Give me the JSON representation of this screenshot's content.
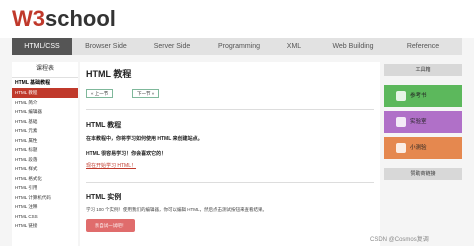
{
  "logo": {
    "w3": "W3",
    "school": "school"
  },
  "nav": [
    {
      "label": "HTML/CSS",
      "active": true
    },
    {
      "label": "Browser Side"
    },
    {
      "label": "Server Side"
    },
    {
      "label": "Programming"
    },
    {
      "label": "XML"
    },
    {
      "label": "Web Building"
    },
    {
      "label": "Reference"
    }
  ],
  "sidebar": {
    "title": "课程表",
    "group": "HTML 基础教程",
    "items": [
      {
        "label": "HTML 教程",
        "active": true
      },
      {
        "label": "HTML 简介"
      },
      {
        "label": "HTML 编辑器"
      },
      {
        "label": "HTML 基础"
      },
      {
        "label": "HTML 元素"
      },
      {
        "label": "HTML 属性"
      },
      {
        "label": "HTML 标题"
      },
      {
        "label": "HTML 段落"
      },
      {
        "label": "HTML 样式"
      },
      {
        "label": "HTML 格式化"
      },
      {
        "label": "HTML 引用"
      },
      {
        "label": "HTML 计算机代码"
      },
      {
        "label": "HTML 注释"
      },
      {
        "label": "HTML CSS"
      },
      {
        "label": "HTML 链接"
      }
    ]
  },
  "main": {
    "title": "HTML 教程",
    "prev": "« 上一节",
    "next": "下一节 »",
    "section1": {
      "title": "HTML 教程",
      "line1": "在本教程中，你将学习如何使用 HTML 来创建站点。",
      "line2": "HTML 很容易学习！你会喜欢它的！",
      "link": "现在开始学习 HTML！"
    },
    "section2": {
      "title": "HTML 实例",
      "desc": "学习 100 个实例！使用我们的编辑器，你可以编辑 HTML，然后点击测试按钮来查看结果。",
      "cta": "亲自试一试吧！"
    }
  },
  "right": {
    "tools_title": "工具箱",
    "tools": [
      {
        "label": "参考书",
        "color": "#5cb85c"
      },
      {
        "label": "实验室",
        "color": "#b070c8"
      },
      {
        "label": "小测验",
        "color": "#e5884f"
      }
    ],
    "sponsor_title": "赞助商链接"
  },
  "watermark": "CSDN @Cosmos复调"
}
